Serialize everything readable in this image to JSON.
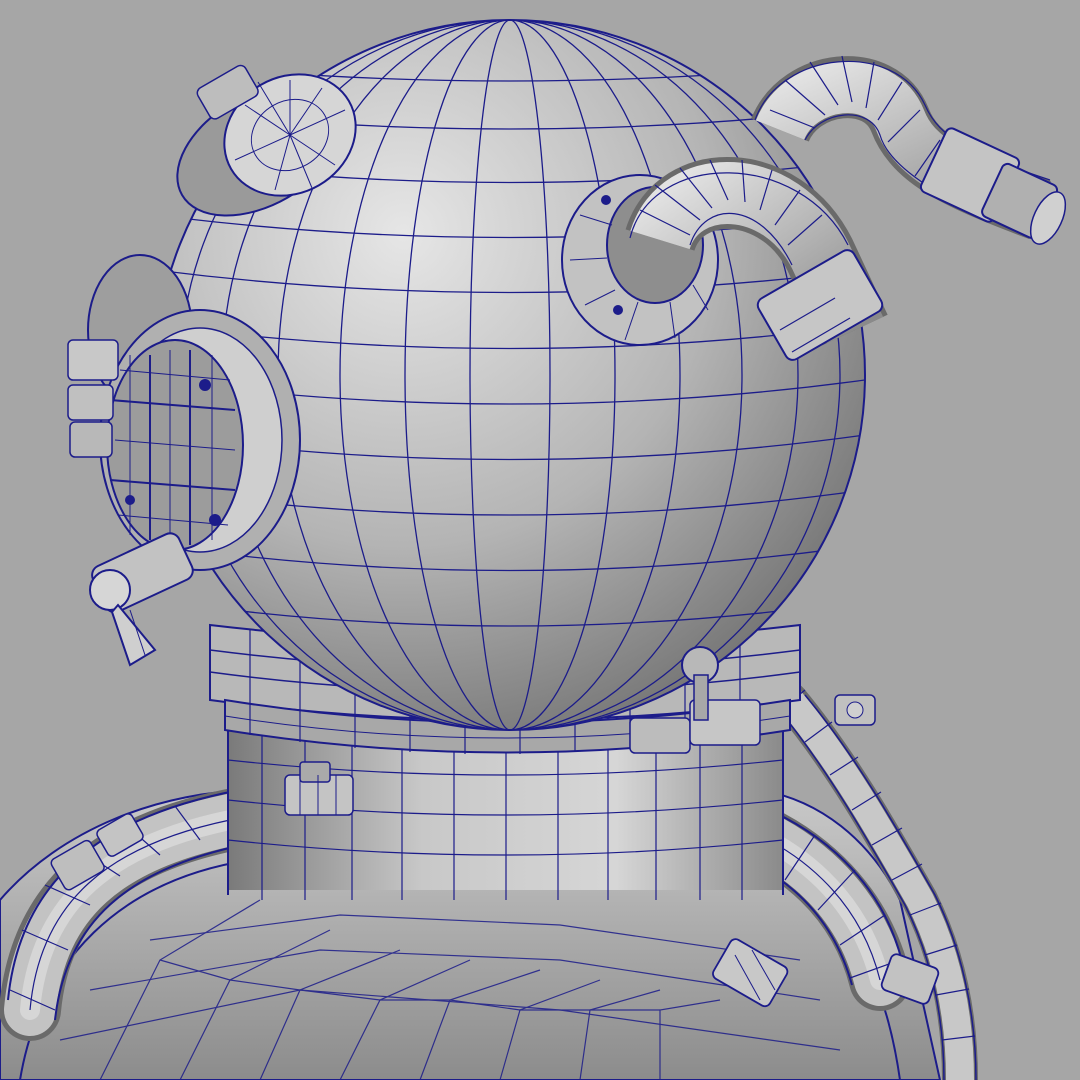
{
  "viewport": {
    "background_color": "#a6a6a6",
    "wireframe_color": "#1c1c8a",
    "surface_light": "#d4d4d4",
    "surface_mid": "#a2a2a2",
    "surface_dark": "#6a6a6a",
    "subject": "diving-helmet-wireframe-model",
    "shading_mode": "wireframe-on-shaded"
  }
}
